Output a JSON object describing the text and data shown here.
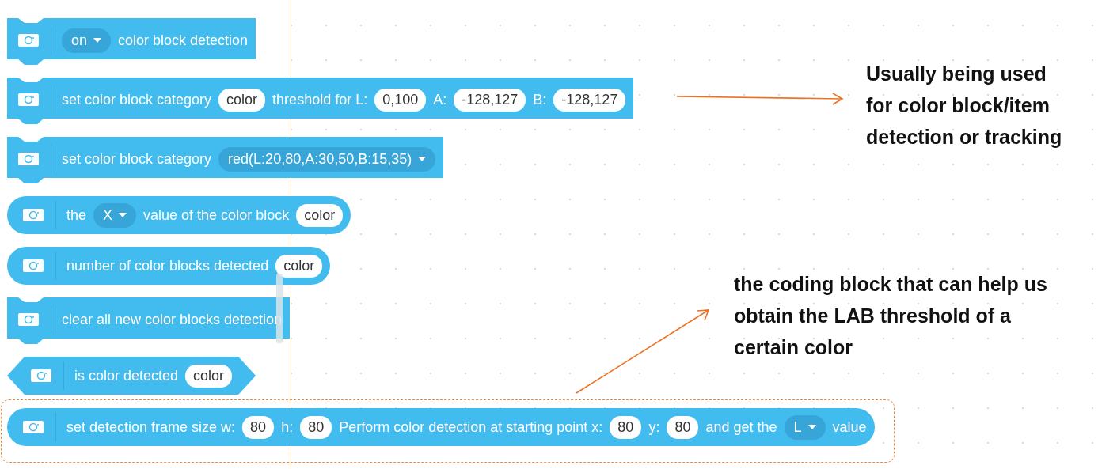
{
  "blocks": [
    {
      "kind": "command",
      "parts": [
        {
          "kind": "dropdown",
          "text": "on"
        },
        {
          "kind": "text",
          "text": "color block detection"
        }
      ]
    },
    {
      "kind": "command",
      "parts": [
        {
          "kind": "text",
          "text": "set color block category"
        },
        {
          "kind": "input",
          "text": "color"
        },
        {
          "kind": "text",
          "text": "threshold for L:"
        },
        {
          "kind": "input",
          "text": "0,100"
        },
        {
          "kind": "text",
          "text": "A:"
        },
        {
          "kind": "input",
          "text": "-128,127"
        },
        {
          "kind": "text",
          "text": "B:"
        },
        {
          "kind": "input",
          "text": "-128,127"
        }
      ]
    },
    {
      "kind": "command",
      "parts": [
        {
          "kind": "text",
          "text": "set color block category"
        },
        {
          "kind": "dropdown",
          "text": "red(L:20,80,A:30,50,B:15,35)"
        }
      ]
    },
    {
      "kind": "reporter",
      "parts": [
        {
          "kind": "text",
          "text": "the"
        },
        {
          "kind": "dropdown",
          "text": "X"
        },
        {
          "kind": "text",
          "text": "value of the color block"
        },
        {
          "kind": "input",
          "text": "color"
        }
      ]
    },
    {
      "kind": "reporter",
      "parts": [
        {
          "kind": "text",
          "text": "number of color blocks detected"
        },
        {
          "kind": "input",
          "text": "color"
        }
      ]
    },
    {
      "kind": "command",
      "parts": [
        {
          "kind": "text",
          "text": "clear all new color blocks detection"
        }
      ]
    },
    {
      "kind": "boolean",
      "parts": [
        {
          "kind": "text",
          "text": "is color detected"
        },
        {
          "kind": "input",
          "text": "color"
        }
      ]
    },
    {
      "kind": "reporter",
      "highlighted": true,
      "parts": [
        {
          "kind": "text",
          "text": "set detection frame size w:"
        },
        {
          "kind": "input",
          "text": "80"
        },
        {
          "kind": "text",
          "text": "h:"
        },
        {
          "kind": "input",
          "text": "80"
        },
        {
          "kind": "text",
          "text": "Perform color detection at starting point x:"
        },
        {
          "kind": "input",
          "text": "80"
        },
        {
          "kind": "text",
          "text": "y:"
        },
        {
          "kind": "input",
          "text": "80"
        },
        {
          "kind": "text",
          "text": "and get the"
        },
        {
          "kind": "dropdown",
          "text": "L"
        },
        {
          "kind": "text",
          "text": "value"
        }
      ]
    }
  ],
  "notes": [
    {
      "text": "Usually being used for color block/item detection or tracking"
    },
    {
      "text": "the coding block that can help us obtain the LAB threshold of a certain color"
    }
  ]
}
